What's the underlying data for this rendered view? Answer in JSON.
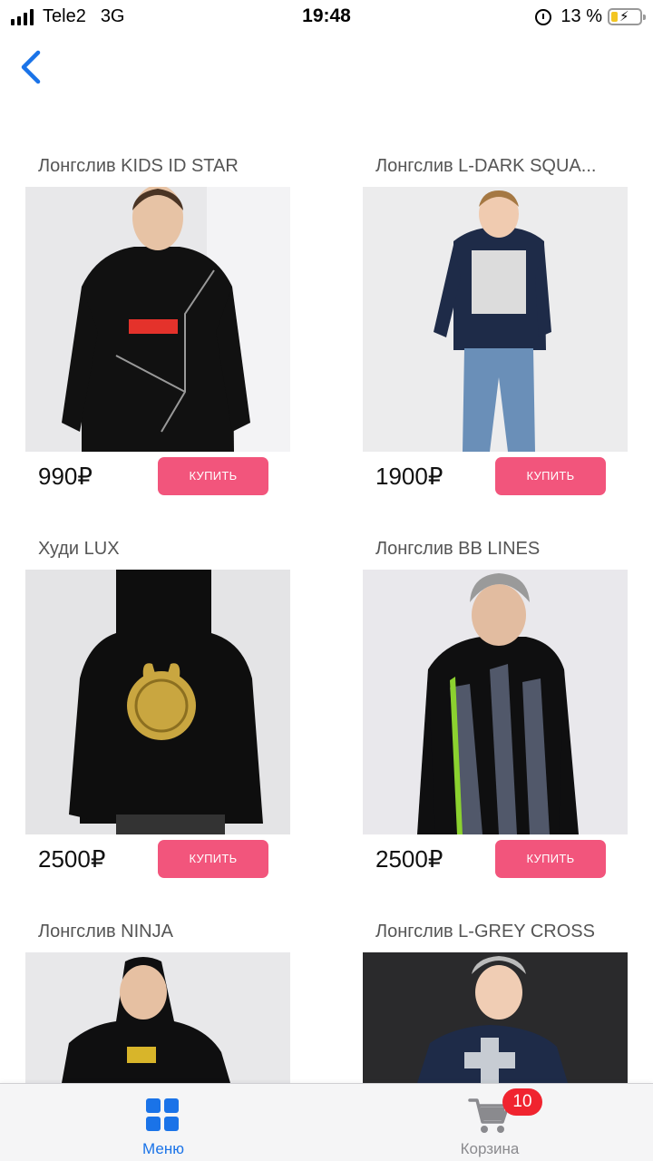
{
  "status_bar": {
    "carrier": "Tele2",
    "network": "3G",
    "time": "19:48",
    "battery": "13 %"
  },
  "products": [
    {
      "title": "Лонгслив KIDS ID STAR",
      "price": "990₽",
      "buy_label": "КУПИТЬ"
    },
    {
      "title": "Лонгслив L-DARK SQUA...",
      "price": "1900₽",
      "buy_label": "КУПИТЬ"
    },
    {
      "title": "Худи LUX",
      "price": "2500₽",
      "buy_label": "КУПИТЬ"
    },
    {
      "title": "Лонгслив BB LINES",
      "price": "2500₽",
      "buy_label": "КУПИТЬ"
    },
    {
      "title": "Лонгслив NINJA",
      "price": "",
      "buy_label": ""
    },
    {
      "title": "Лонгслив L-GREY CROSS",
      "price": "",
      "buy_label": ""
    }
  ],
  "tab_bar": {
    "menu_label": "Меню",
    "cart_label": "Корзина",
    "cart_badge": "10"
  },
  "colors": {
    "accent": "#1a73e8",
    "buy_button": "#f2557c",
    "badge": "#f0242f"
  }
}
